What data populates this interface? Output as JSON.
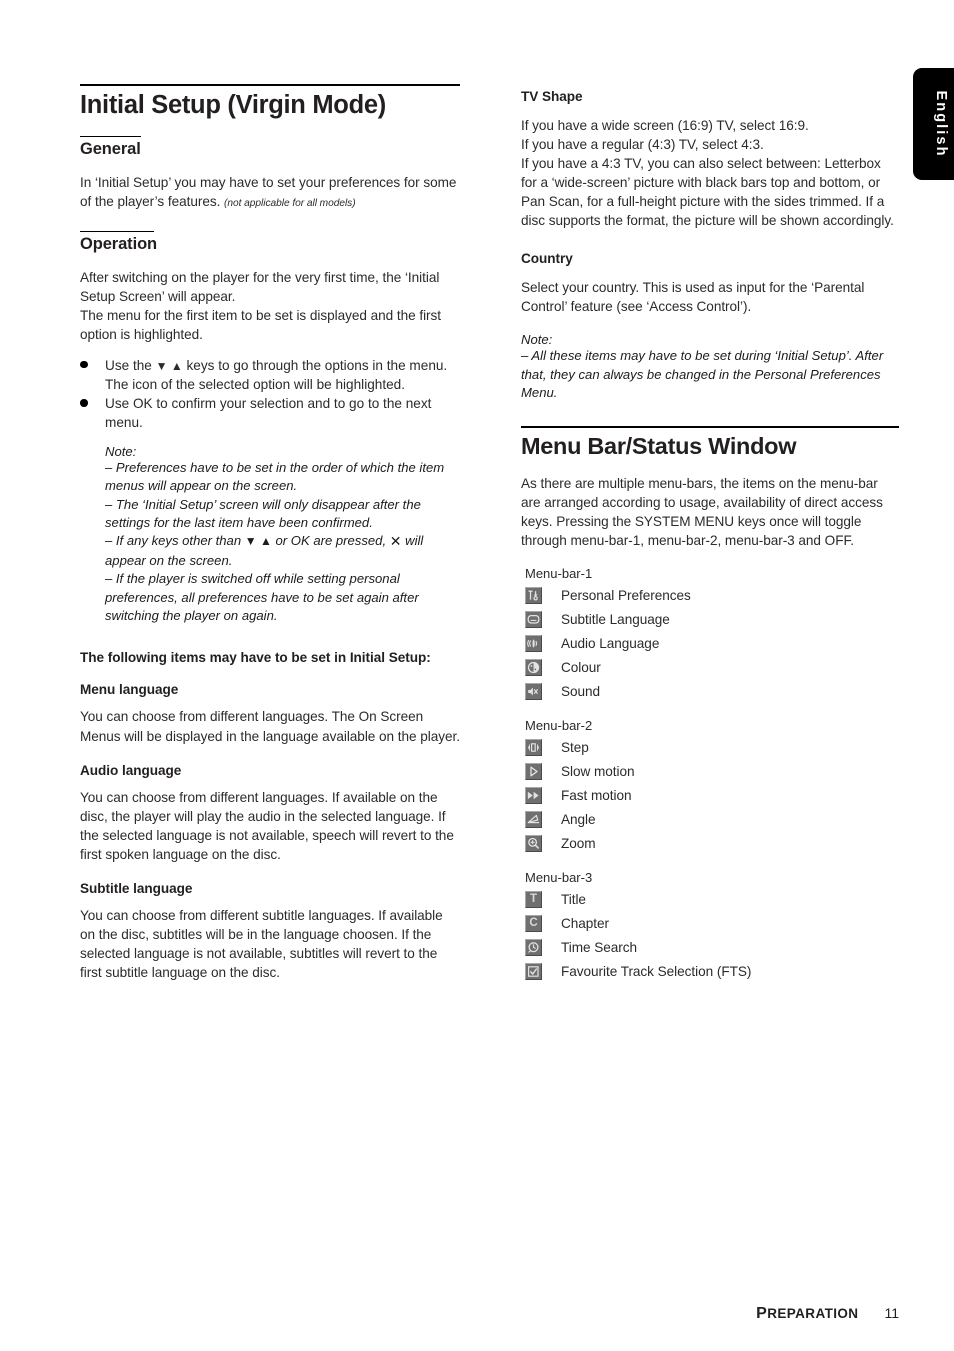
{
  "side_tab": {
    "label": "English"
  },
  "footer": {
    "chapter": "Preparation",
    "page": "11"
  },
  "left": {
    "title": "Initial Setup (Virgin Mode)",
    "general": {
      "heading": "General",
      "para1": "In ‘Initial Setup’ you may have to set your preferences for some of the player’s features.",
      "para1_note": "(not applicable for all models)"
    },
    "operation": {
      "heading": "Operation",
      "para1": "After switching on the player for the very first time, the ‘Initial Setup Screen’ will appear.",
      "para2": "The menu for the first item to be set is displayed and the first option is highlighted.",
      "bullet1_pre": "Use the ",
      "bullet1_arrows": "▼ ▲",
      "bullet1_post": " keys to go through the options in the menu. The icon of the selected option will be highlighted.",
      "bullet2": "Use OK to confirm your selection and to go to the next menu."
    },
    "note": {
      "label": "Note:",
      "item1": "–  Preferences have to be set in the order of which the item menus will appear on the screen.",
      "item2": "–  The ‘Initial Setup’ screen will only disappear after the settings for the last item have been confirmed.",
      "item3_pre": "–  If any keys other than ",
      "item3_arrows": "▼ ▲",
      "item3_mid": " or OK are pressed, ",
      "item3_symbol": "✕",
      "item3_post": " will appear on the screen.",
      "item4": "–  If the player is switched off while setting personal preferences, all preferences have to be set again after switching the player on again."
    },
    "following_items_heading": "The following items may have to be set in Initial Setup:",
    "sections": [
      {
        "heading": "Menu language",
        "body": "You can choose from different languages. The On Screen Menus will be displayed in the language available on the player."
      },
      {
        "heading": "Audio language",
        "body": "You can choose from different languages. If available on the disc, the player will play the audio in the selected language. If the selected language is not available, speech will revert to the first spoken language on the disc."
      },
      {
        "heading": "Subtitle language",
        "body": "You can choose from different subtitle languages. If available on the disc, subtitles will be in the language choosen. If the selected language is not available, subtitles will revert to the first subtitle language on the disc."
      }
    ]
  },
  "right": {
    "tv_shape": {
      "heading": "TV Shape",
      "line1": "If you have a wide screen (16:9) TV, select 16:9.",
      "line2": "If you have a regular (4:3) TV, select 4:3.",
      "line3": "If you have a 4:3 TV, you can also select between: Letterbox for a ‘wide-screen’ picture with black bars top and bottom, or Pan Scan, for a full-height picture with the sides trimmed. If a disc supports the format, the picture will be shown accordingly."
    },
    "country": {
      "heading": "Country",
      "body": "Select your country. This is used as input for the ‘Parental Control’ feature (see ‘Access Control’)."
    },
    "note": {
      "label": "Note:",
      "item1": "–  All these items may have to be set during ‘Initial Setup’. After that, they can always be changed in the Personal Preferences Menu."
    },
    "menu_bar": {
      "title": "Menu Bar/Status Window",
      "intro": "As there are multiple menu-bars, the items on the menu-bar are arranged according to usage, availability of direct access keys. Pressing the SYSTEM MENU keys once will toggle through menu-bar-1, menu-bar-2, menu-bar-3 and OFF.",
      "groups": [
        {
          "label": "Menu-bar-1",
          "items": [
            {
              "icon": "personal-preferences-icon",
              "label": "Personal Preferences"
            },
            {
              "icon": "subtitle-language-icon",
              "label": "Subtitle Language"
            },
            {
              "icon": "audio-language-icon",
              "label": "Audio Language"
            },
            {
              "icon": "colour-icon",
              "label": "Colour"
            },
            {
              "icon": "sound-icon",
              "label": "Sound"
            }
          ]
        },
        {
          "label": "Menu-bar-2",
          "items": [
            {
              "icon": "step-icon",
              "label": "Step"
            },
            {
              "icon": "slow-motion-icon",
              "label": "Slow motion"
            },
            {
              "icon": "fast-motion-icon",
              "label": "Fast motion"
            },
            {
              "icon": "angle-icon",
              "label": "Angle"
            },
            {
              "icon": "zoom-icon",
              "label": "Zoom"
            }
          ]
        },
        {
          "label": "Menu-bar-3",
          "items": [
            {
              "icon": "title-icon",
              "label": "Title"
            },
            {
              "icon": "chapter-icon",
              "label": "Chapter"
            },
            {
              "icon": "time-search-icon",
              "label": "Time Search"
            },
            {
              "icon": "favourite-track-selection-icon",
              "label": "Favourite Track Selection (FTS)"
            }
          ]
        }
      ]
    }
  },
  "colors": {
    "text": "#2b2b2b",
    "icon_face": "#6f6f6f",
    "icon_glyph": "#d8d8d8",
    "tab_bg": "#000000"
  }
}
